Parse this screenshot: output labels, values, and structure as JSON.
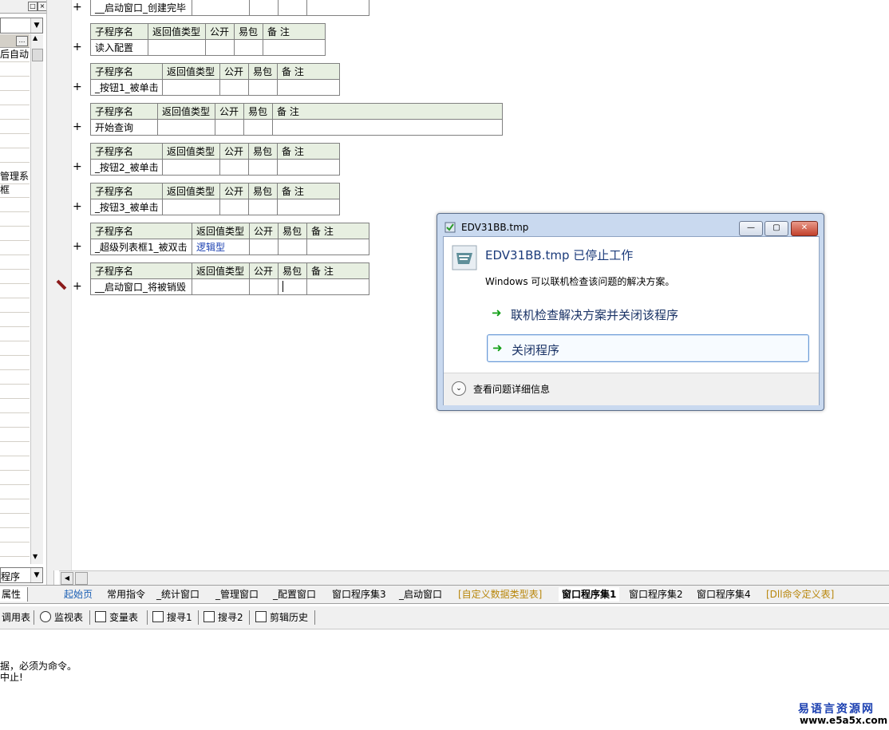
{
  "left_panel": {
    "row1_label": "后自动",
    "row_mgr": "管理系",
    "row_frame": "框",
    "combo2_value": "程序",
    "tab_label": "属性"
  },
  "procs": [
    {
      "name": "__启动窗口_创建完毕",
      "type": ""
    },
    {
      "name": "读入配置",
      "type": ""
    },
    {
      "name": "_按钮1_被单击",
      "type": ""
    },
    {
      "name": "开始查询",
      "type": ""
    },
    {
      "name": "_按钮2_被单击",
      "type": ""
    },
    {
      "name": "_按钮3_被单击",
      "type": ""
    },
    {
      "name": "_超级列表框1_被双击",
      "type": "逻辑型"
    },
    {
      "name": "__启动窗口_将被销毁",
      "type": ""
    }
  ],
  "headers": {
    "name": "子程序名",
    "ret": "返回值类型",
    "public": "公开",
    "easy": "易包",
    "note": "备 注"
  },
  "plus": "+",
  "tabs": [
    {
      "label": "起始页",
      "color": "#1a5fb4"
    },
    {
      "label": "常用指令",
      "color": "#000000"
    },
    {
      "label": "_统计窗口",
      "color": "#000000"
    },
    {
      "label": "_管理窗口",
      "color": "#000000"
    },
    {
      "label": "_配置窗口",
      "color": "#000000"
    },
    {
      "label": "窗口程序集3",
      "color": "#000000"
    },
    {
      "label": "_启动窗口",
      "color": "#000000"
    },
    {
      "label": "[自定义数据类型表]",
      "color": "#b8860b"
    },
    {
      "label": "窗口程序集1",
      "color": "#000000"
    },
    {
      "label": "窗口程序集2",
      "color": "#000000"
    },
    {
      "label": "窗口程序集4",
      "color": "#000000"
    },
    {
      "label": "[Dll命令定义表]",
      "color": "#b8860b"
    }
  ],
  "toolbar": [
    "调用表",
    "监视表",
    "变量表",
    "搜寻1",
    "搜寻2",
    "剪辑历史"
  ],
  "output": {
    "line1": "据，必须为命令。",
    "line2": "中止!"
  },
  "dialog": {
    "title": "EDV31BB.tmp",
    "heading": "EDV31BB.tmp 已停止工作",
    "desc": "Windows 可以联机检查该问题的解决方案。",
    "option1": "联机检查解决方案并关闭该程序",
    "option2": "关闭程序",
    "details": "查看问题详细信息"
  },
  "watermark": {
    "cn": "易语言资源网",
    "url": "www.e5a5x.com"
  }
}
